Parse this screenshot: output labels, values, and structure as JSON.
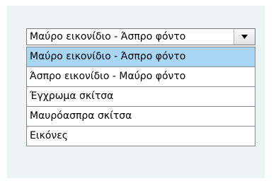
{
  "dropdown": {
    "selected_value": "Μαύρο εικονίδιο - Άσπρο φόντο",
    "arrow_icon": "chevron-down-icon",
    "highlight_color": "#a9d6f5",
    "options": [
      {
        "label": "Μαύρο εικονίδιο - Άσπρο φόντο",
        "highlighted": true
      },
      {
        "label": "Άσπρο εικονίδιο - Μαύρο φόντο",
        "highlighted": false
      },
      {
        "label": "Έγχρωμα σκίτσα",
        "highlighted": false
      },
      {
        "label": "Μαυρόασπρα σκίτσα",
        "highlighted": false
      },
      {
        "label": "Εικόνες",
        "highlighted": false
      }
    ]
  }
}
